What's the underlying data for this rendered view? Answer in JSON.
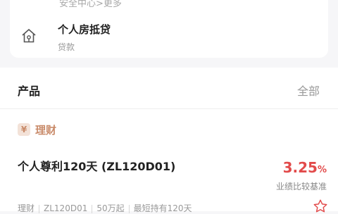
{
  "top_card": {
    "breadcrumb": "安全中心>更多",
    "mortgage": {
      "title": "个人房抵贷",
      "subtitle": "贷款",
      "icon": "house-icon"
    }
  },
  "products": {
    "section_label": "产品",
    "all_label": "全部",
    "category": {
      "badge": "¥",
      "name": "理财"
    },
    "item": {
      "name": "个人尊利120天 (ZL120D01)",
      "rate_value": "3.25",
      "rate_unit": "%",
      "rate_label": "业绩比较基准",
      "tags": [
        "理财",
        "ZL120D01",
        "50万起",
        "最短持有120天"
      ],
      "fav_icon": "star-icon"
    }
  },
  "colors": {
    "accent_red": "#e24b4b",
    "category_brown": "#c98b6a"
  }
}
